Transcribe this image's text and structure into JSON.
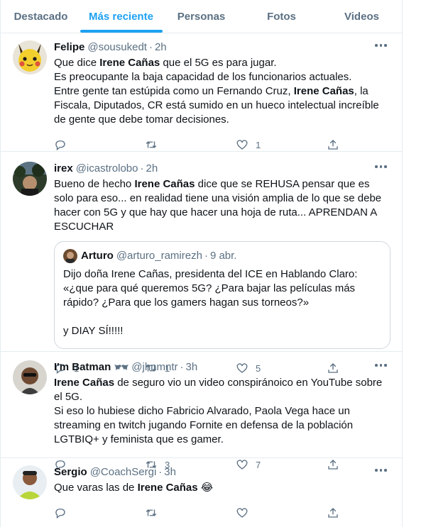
{
  "tabs": [
    "Destacado",
    "Más reciente",
    "Personas",
    "Fotos",
    "Videos"
  ],
  "tweets": [
    {
      "name": "Felipe",
      "handle": "@sousukedt",
      "sep": "·",
      "time": "2h",
      "lines": [
        [
          "Que dice ",
          "Irene Cañas",
          " que el 5G es para jugar."
        ],
        [
          "Es preocupante la baja capacidad de los funcionarios actuales."
        ],
        [
          "Entre gente tan estúpida como un Fernando Cruz, ",
          "Irene Cañas",
          ", la Fiscala, Diputados, CR está sumido en un hueco intelectual increíble de gente que debe tomar decisiones."
        ]
      ],
      "replies": "",
      "retweets": "",
      "likes": "1"
    },
    {
      "name": "irex",
      "handle": "@icastrolobo",
      "sep": "·",
      "time": "2h",
      "lines": [
        [
          "Bueno de hecho ",
          "Irene Cañas",
          " dice que se REHUSA pensar que es solo para eso... en realidad tiene una visión amplia de lo que se debe hacer con 5G y que hay que hacer una hoja de ruta... APRENDAN A ESCUCHAR"
        ]
      ],
      "quote": {
        "name": "Arturo",
        "handle": "@arturo_ramirezh",
        "sep": "·",
        "time": "9 abr.",
        "text": "Dijo doña Irene Cañas, presidenta del ICE en Hablando Claro: «¿que para qué queremos 5G? ¿Para bajar las películas más rápido? ¿Para que los gamers hagan sus torneos?»",
        "text2": "y DIAY SÍ!!!!!"
      },
      "replies": "1",
      "retweets": "1",
      "likes": "5"
    },
    {
      "name": "I'm Batman",
      "handle": "@jhnmntr",
      "sep": "·",
      "time": "3h",
      "lines": [
        [
          "Irene Cañas",
          " de seguro vio un video conspiránoico en YouTube sobre el 5G."
        ],
        [
          "Si eso lo hubiese dicho Fabricio Alvarado, Paola Vega hace un streaming en twitch jugando Fornite en defensa de la población LGTBIQ+ y feminista que es gamer."
        ]
      ],
      "replies": "",
      "retweets": "3",
      "likes": "7"
    },
    {
      "name": "Sergio",
      "handle": "@CoachSergi",
      "sep": "·",
      "time": "3h",
      "lines": [
        [
          "Que varas las de ",
          "Irene Cañas",
          " 😂"
        ]
      ],
      "replies": "",
      "retweets": "",
      "likes": ""
    }
  ],
  "colors": {
    "accent": "#1da1f2",
    "muted": "#5b7083",
    "border": "#e6ecf0"
  },
  "icons": [
    "reply-icon",
    "retweet-icon",
    "like-icon",
    "share-icon",
    "more-icon",
    "bat-icon"
  ]
}
